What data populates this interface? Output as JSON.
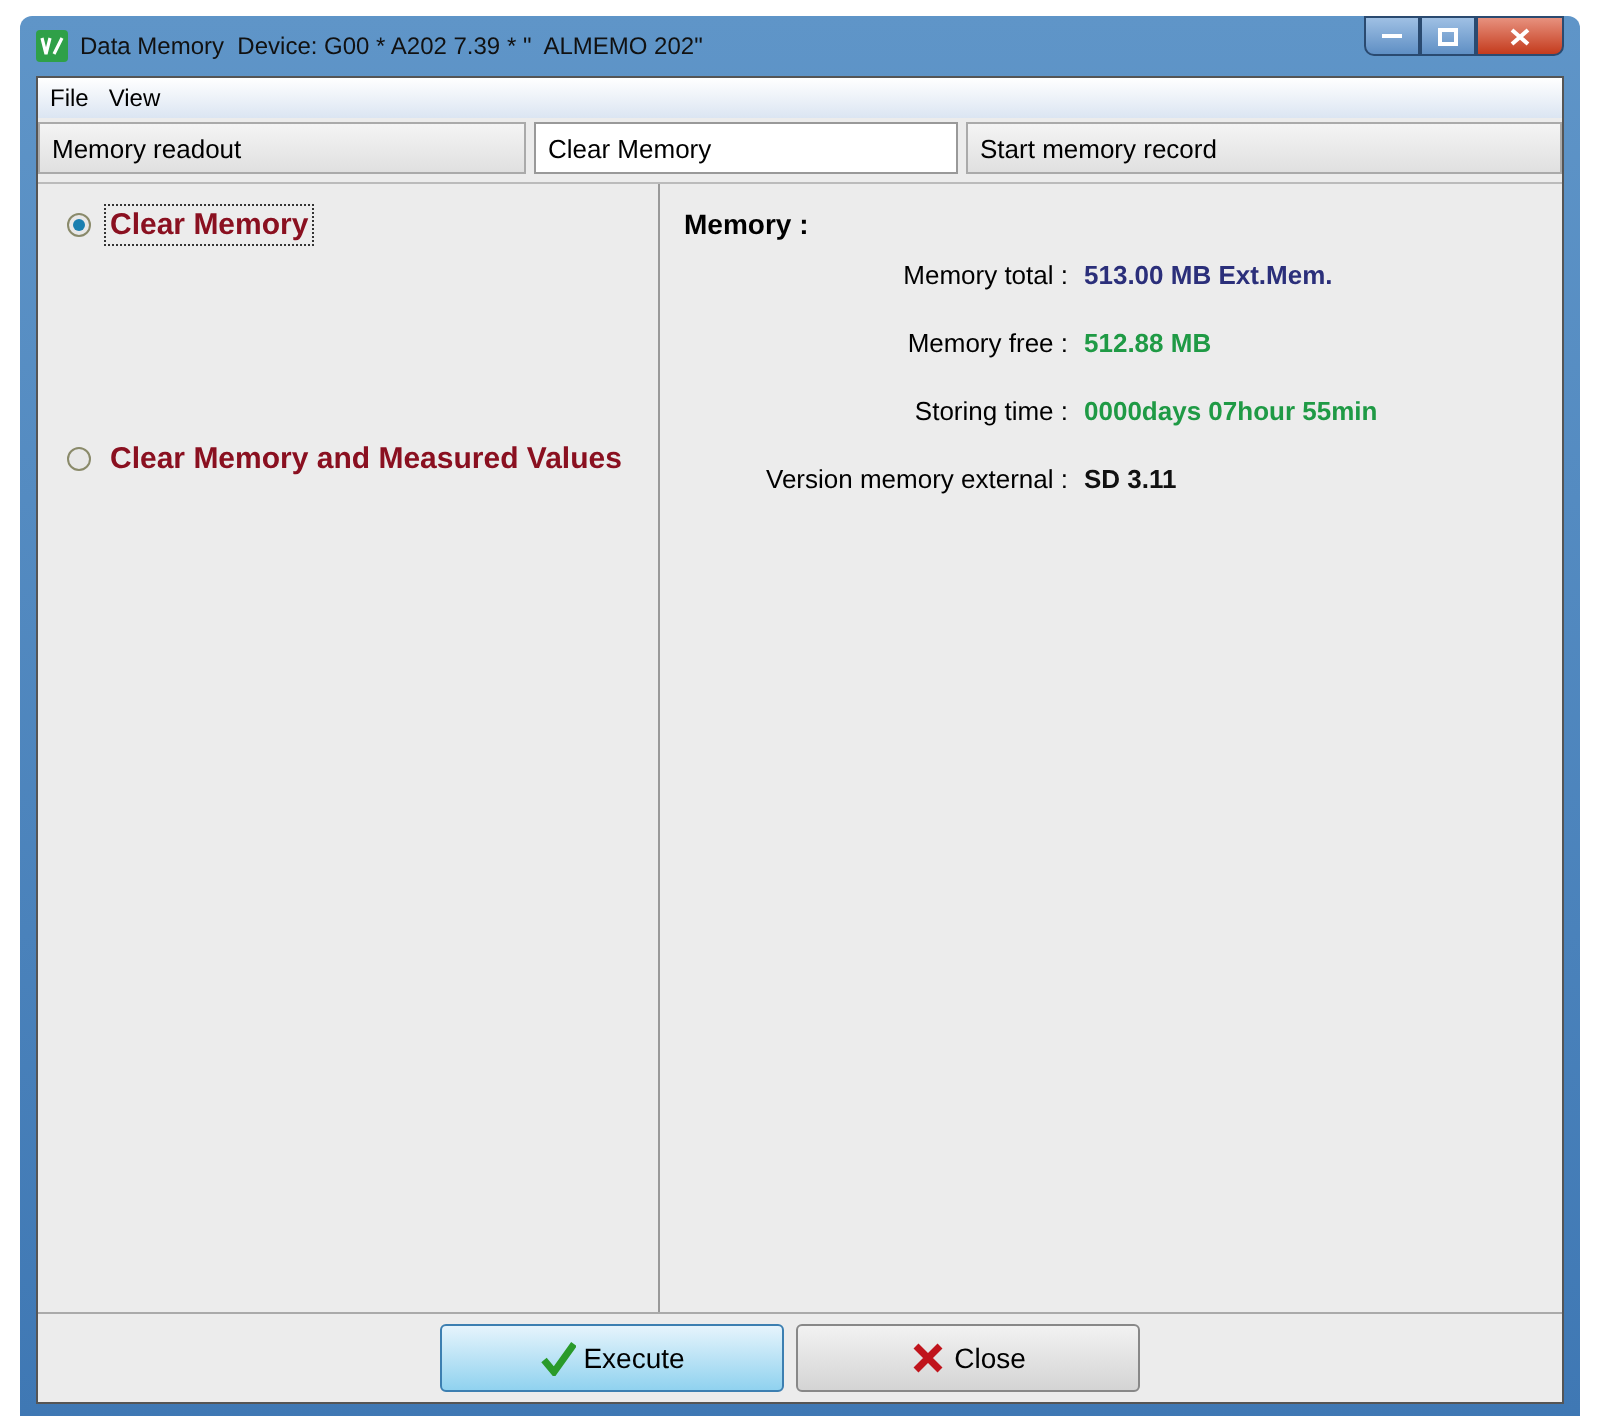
{
  "window": {
    "title": "Data Memory  Device: G00 * A202 7.39 * \"  ALMEMO 202\""
  },
  "menu": [
    "File",
    "View"
  ],
  "tabs": [
    {
      "label": "Memory readout",
      "selected": false
    },
    {
      "label": "Clear Memory",
      "selected": true
    },
    {
      "label": "Start memory record",
      "selected": false
    }
  ],
  "options": [
    {
      "label": "Clear Memory",
      "selected": true
    },
    {
      "label": "Clear Memory and Measured Values",
      "selected": false
    }
  ],
  "memory": {
    "heading": "Memory :",
    "rows": [
      {
        "label": "Memory total :",
        "value": "513.00 MB  Ext.Mem.",
        "color": "#2b2f7a"
      },
      {
        "label": "Memory free :",
        "value": "512.88 MB",
        "color": "#1f9a45"
      },
      {
        "label": "Storing time :",
        "value": "0000days 07hour 55min",
        "color": "#1f9a45"
      },
      {
        "label": "Version memory external :",
        "value": "SD 3.11",
        "color": "#111111"
      }
    ]
  },
  "buttons": [
    {
      "label": "Execute",
      "kind": "execute"
    },
    {
      "label": "Close",
      "kind": "close"
    }
  ]
}
